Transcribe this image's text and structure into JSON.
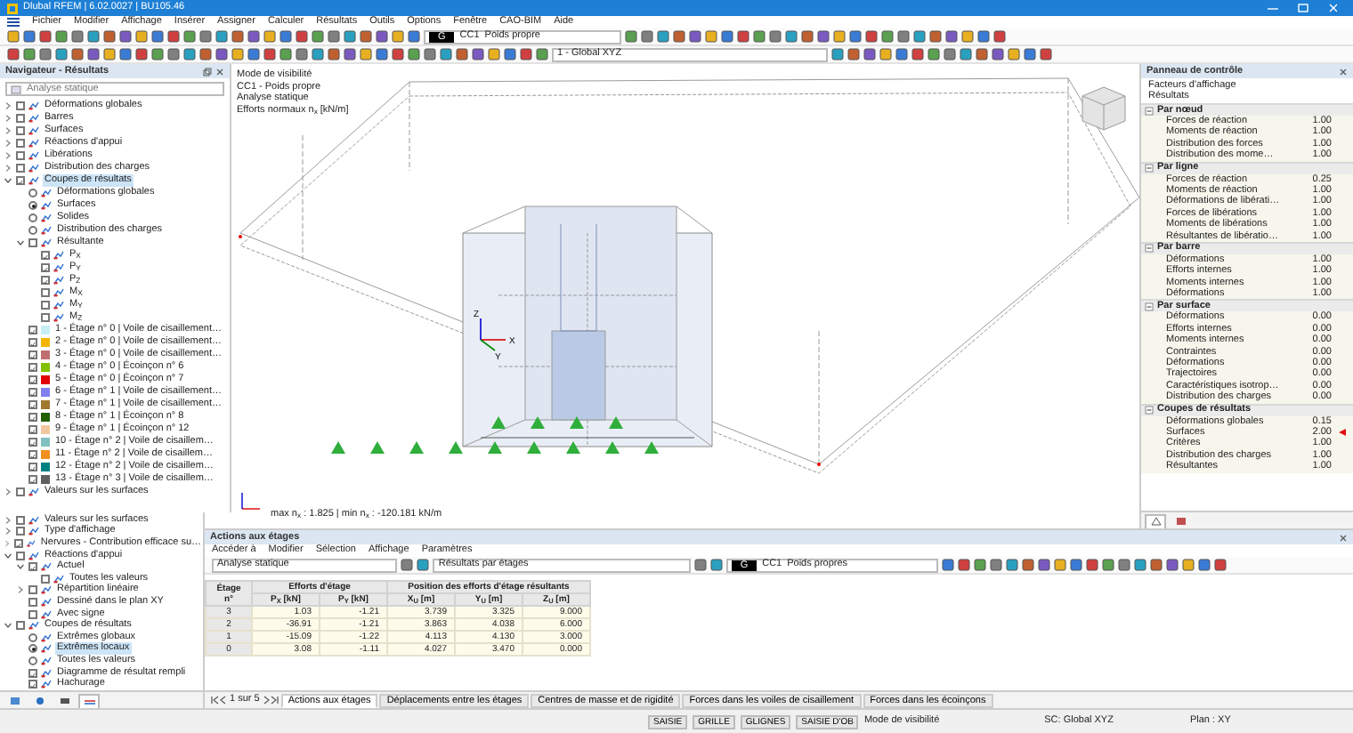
{
  "window": {
    "title": "Dlubal RFEM | 6.02.0027 | BU105.46"
  },
  "menu": [
    "Fichier",
    "Modifier",
    "Affichage",
    "Insérer",
    "Assigner",
    "Calculer",
    "Résultats",
    "Outils",
    "Options",
    "Fenêtre",
    "CAO-BIM",
    "Aide"
  ],
  "toolbar": {
    "case_badge": "G",
    "case": "CC1",
    "case_name": "Poids propre",
    "coordinate_system": "1 - Global XYZ"
  },
  "navigator": {
    "title": "Navigateur - Résultats",
    "analysis": "Analyse statique",
    "tree": [
      {
        "label": "Déformations globales",
        "kind": "checkbox",
        "checked": false,
        "expanded": false,
        "selected": false
      },
      {
        "label": "Barres",
        "kind": "checkbox",
        "checked": false,
        "expanded": false,
        "selected": false
      },
      {
        "label": "Surfaces",
        "kind": "checkbox",
        "checked": false,
        "expanded": false,
        "selected": false
      },
      {
        "label": "Réactions d'appui",
        "kind": "checkbox",
        "checked": false,
        "expanded": false,
        "selected": false
      },
      {
        "label": "Libérations",
        "kind": "checkbox",
        "checked": false,
        "expanded": false,
        "selected": false
      },
      {
        "label": "Distribution des charges",
        "kind": "checkbox",
        "checked": false,
        "expanded": false,
        "selected": false
      },
      {
        "label": "Coupes de résultats",
        "kind": "checkbox",
        "checked": true,
        "expanded": true,
        "selected": true,
        "children": [
          {
            "label": "Déformations globales",
            "kind": "radio",
            "checked": false,
            "selected": false
          },
          {
            "label": "Surfaces",
            "kind": "radio",
            "checked": true,
            "selected": false
          },
          {
            "label": "Solides",
            "kind": "radio",
            "checked": false,
            "selected": false
          },
          {
            "label": "Distribution des charges",
            "kind": "radio",
            "checked": false,
            "selected": false
          },
          {
            "label": "Résultante",
            "kind": "checkbox",
            "checked": false,
            "expanded": true,
            "selected": false,
            "children": [
              {
                "label": "P$_{X}$",
                "kind": "checkbox",
                "checked": true,
                "selected": false
              },
              {
                "label": "P$_{Y}$",
                "kind": "checkbox",
                "checked": true,
                "selected": false
              },
              {
                "label": "P$_{Z}$",
                "kind": "checkbox",
                "checked": true,
                "selected": false
              },
              {
                "label": "M$_{X}$",
                "kind": "checkbox",
                "checked": false,
                "selected": false
              },
              {
                "label": "M$_{Y}$",
                "kind": "checkbox",
                "checked": false,
                "selected": false
              },
              {
                "label": "M$_{Z}$",
                "kind": "checkbox",
                "checked": false,
                "selected": false
              }
            ]
          },
          {
            "label": "1 - Étage n° 0 | Voile de cisaillement…",
            "kind": "checkbox",
            "checked": true,
            "selected": false,
            "color": "#c8eef6"
          },
          {
            "label": "2 - Étage n° 0 | Voile de cisaillement…",
            "kind": "checkbox",
            "checked": true,
            "selected": false,
            "color": "#f2b600"
          },
          {
            "label": "3 - Étage n° 0 | Voile de cisaillement…",
            "kind": "checkbox",
            "checked": true,
            "selected": false,
            "color": "#c07070"
          },
          {
            "label": "4 - Étage n° 0 | Écoinçon n° 6",
            "kind": "checkbox",
            "checked": true,
            "selected": false,
            "color": "#80c000"
          },
          {
            "label": "5 - Étage n° 0 | Écoinçon n° 7",
            "kind": "checkbox",
            "checked": true,
            "selected": false,
            "color": "#e00000"
          },
          {
            "label": "6 - Étage n° 1 | Voile de cisaillement…",
            "kind": "checkbox",
            "checked": true,
            "selected": false,
            "color": "#8080f0"
          },
          {
            "label": "7 - Étage n° 1 | Voile de cisaillement…",
            "kind": "checkbox",
            "checked": true,
            "selected": false,
            "color": "#a07830"
          },
          {
            "label": "8 - Étage n° 1 | Écoinçon n° 8",
            "kind": "checkbox",
            "checked": true,
            "selected": false,
            "color": "#206000"
          },
          {
            "label": "9 - Étage n° 1 | Écoinçon n° 12",
            "kind": "checkbox",
            "checked": true,
            "selected": false,
            "color": "#f0c8a0"
          },
          {
            "label": "10 - Étage n° 2 | Voile de cisaillem…",
            "kind": "checkbox",
            "checked": true,
            "selected": false,
            "color": "#80c0c0"
          },
          {
            "label": "11 - Étage n° 2 | Voile de cisaillem…",
            "kind": "checkbox",
            "checked": true,
            "selected": false,
            "color": "#f09020"
          },
          {
            "label": "12 - Étage n° 2 | Voile de cisaillem…",
            "kind": "checkbox",
            "checked": true,
            "selected": false,
            "color": "#008080"
          },
          {
            "label": "13 - Étage n° 3 | Voile de cisaillem…",
            "kind": "checkbox",
            "checked": true,
            "selected": false,
            "color": "#606060"
          }
        ]
      },
      {
        "label": "Valeurs sur les surfaces",
        "kind": "checkbox",
        "checked": false,
        "expanded": false,
        "selected": false
      }
    ],
    "tree2": [
      {
        "label": "Valeurs sur les surfaces",
        "kind": "checkbox",
        "checked": false,
        "expanded": false,
        "selected": false
      },
      {
        "label": "Type d'affichage",
        "kind": "checkbox",
        "checked": false,
        "expanded": false,
        "selected": false
      },
      {
        "label": "Nervures - Contribution efficace su…",
        "kind": "checkbox",
        "checked": true,
        "expanded": false,
        "selected": false
      },
      {
        "label": "Réactions d'appui",
        "kind": "checkbox",
        "checked": false,
        "expanded": true,
        "selected": false,
        "children": [
          {
            "label": "Actuel",
            "kind": "checkbox",
            "checked": true,
            "expanded": true,
            "selected": false,
            "children": [
              {
                "label": "Toutes les valeurs",
                "kind": "checkbox",
                "checked": false,
                "selected": false
              }
            ]
          },
          {
            "label": "Répartition linéaire",
            "kind": "checkbox",
            "checked": false,
            "expanded": false,
            "selected": false
          },
          {
            "label": "Dessiné dans le plan XY",
            "kind": "checkbox",
            "checked": false,
            "selected": false
          },
          {
            "label": "Avec signe",
            "kind": "checkbox",
            "checked": false,
            "selected": false
          }
        ]
      },
      {
        "label": "Coupes de résultats",
        "kind": "checkbox",
        "checked": false,
        "expanded": true,
        "selected": false,
        "children": [
          {
            "label": "Extrêmes globaux",
            "kind": "radio",
            "checked": false,
            "selected": false
          },
          {
            "label": "Extrêmes locaux",
            "kind": "radio",
            "checked": true,
            "selected": true
          },
          {
            "label": "Toutes les valeurs",
            "kind": "radio",
            "checked": false,
            "selected": false
          },
          {
            "label": "Diagramme de résultat rempli",
            "kind": "checkbox",
            "checked": true,
            "selected": false
          },
          {
            "label": "Hachurage",
            "kind": "checkbox",
            "checked": true,
            "selected": false
          }
        ]
      }
    ],
    "bottom_tabs": [
      {
        "selected": false
      },
      {
        "selected": false
      },
      {
        "selected": false
      },
      {
        "selected": true
      }
    ]
  },
  "view": {
    "info": [
      "Mode de visibilité",
      "CC1 - Poids propre",
      "Analyse statique",
      "Efforts normaux n$_{x}$ [kN/m]"
    ],
    "summary": "max n$_{x}$ : 1.825 | min n$_{x}$ : -120.181 kN/m",
    "axes": [
      "X",
      "Y",
      "Z"
    ]
  },
  "control_panel": {
    "title": "Panneau de contrôle",
    "subtitle": "Facteurs d'affichage",
    "section": "Résultats",
    "groups": [
      {
        "title": "Par nœud",
        "expanded": true,
        "rows": [
          {
            "label": "Forces de réaction",
            "value": "1.00",
            "marked": false
          },
          {
            "label": "Moments de réaction",
            "value": "1.00",
            "marked": false
          },
          {
            "label": "Distribution des forces",
            "value": "1.00",
            "marked": false
          },
          {
            "label": "Distribution des mome…",
            "value": "1.00",
            "marked": false
          }
        ]
      },
      {
        "title": "Par ligne",
        "expanded": true,
        "rows": [
          {
            "label": "Forces de réaction",
            "value": "0.25",
            "marked": false
          },
          {
            "label": "Moments de réaction",
            "value": "1.00",
            "marked": false
          },
          {
            "label": "Déformations de libérati…",
            "value": "1.00",
            "marked": false
          },
          {
            "label": "Forces de libérations",
            "value": "1.00",
            "marked": false
          },
          {
            "label": "Moments de libérations",
            "value": "1.00",
            "marked": false
          },
          {
            "label": "Résultantes de libératio…",
            "value": "1.00",
            "marked": false
          }
        ]
      },
      {
        "title": "Par barre",
        "expanded": true,
        "rows": [
          {
            "label": "Déformations",
            "value": "1.00",
            "marked": false
          },
          {
            "label": "Efforts internes",
            "value": "1.00",
            "marked": false
          },
          {
            "label": "Moments internes",
            "value": "1.00",
            "marked": false
          },
          {
            "label": "Déformations",
            "value": "1.00",
            "marked": false
          }
        ]
      },
      {
        "title": "Par surface",
        "expanded": true,
        "rows": [
          {
            "label": "Déformations",
            "value": "0.00",
            "marked": false
          },
          {
            "label": "Efforts internes",
            "value": "0.00",
            "marked": false
          },
          {
            "label": "Moments internes",
            "value": "0.00",
            "marked": false
          },
          {
            "label": "Contraintes",
            "value": "0.00",
            "marked": false
          },
          {
            "label": "Déformations",
            "value": "0.00",
            "marked": false
          },
          {
            "label": "Trajectoires",
            "value": "0.00",
            "marked": false
          },
          {
            "label": "Caractéristiques isotrop…",
            "value": "0.00",
            "marked": false
          },
          {
            "label": "Distribution des charges",
            "value": "0.00",
            "marked": false
          }
        ]
      },
      {
        "title": "Coupes de résultats",
        "expanded": true,
        "rows": [
          {
            "label": "Déformations globales",
            "value": "0.15",
            "marked": false
          },
          {
            "label": "Surfaces",
            "value": "2.00",
            "marked": true
          },
          {
            "label": "Critères",
            "value": "1.00",
            "marked": false
          },
          {
            "label": "Distribution des charges",
            "value": "1.00",
            "marked": false
          },
          {
            "label": "Résultantes",
            "value": "1.00",
            "marked": false
          }
        ]
      }
    ]
  },
  "table_panel": {
    "title": "Actions aux étages",
    "menu": [
      "Accéder à",
      "Modifier",
      "Sélection",
      "Affichage",
      "Paramètres"
    ],
    "analysis": "Analyse statique",
    "results": "Résultats par étages",
    "case_badge": "G",
    "case": "CC1",
    "case_name": "Poids propres",
    "first_column": "Étage n°",
    "column_groups": [
      {
        "label": "Efforts d'étage",
        "columns": [
          "P$_{X}$ [kN]",
          "P$_{Y}$ [kN]"
        ]
      },
      {
        "label": "Position des efforts d'étage résultants",
        "columns": [
          "X$_{U}$ [m]",
          "Y$_{U}$ [m]",
          "Z$_{U}$ [m]"
        ]
      }
    ],
    "rows": [
      {
        "storey": "3",
        "cells": [
          "1.03",
          "-1.21",
          "3.739",
          "3.325",
          "9.000"
        ]
      },
      {
        "storey": "2",
        "cells": [
          "-36.91",
          "-1.21",
          "3.863",
          "4.038",
          "6.000"
        ]
      },
      {
        "storey": "1",
        "cells": [
          "-15.09",
          "-1.22",
          "4.113",
          "4.130",
          "3.000"
        ]
      },
      {
        "storey": "0",
        "cells": [
          "3.08",
          "-1.11",
          "4.027",
          "3.470",
          "0.000"
        ]
      }
    ],
    "pager": "1 sur 5",
    "tabs": [
      {
        "label": "Actions aux étages",
        "selected": true
      },
      {
        "label": "Déplacements entre les étages",
        "selected": false
      },
      {
        "label": "Centres de masse et de rigidité",
        "selected": false
      },
      {
        "label": "Forces dans les voiles de cisaillement",
        "selected": false
      },
      {
        "label": "Forces dans les écoinçons",
        "selected": false
      }
    ]
  },
  "status_bar": {
    "toggles": [
      "SAISIE",
      "GRILLE",
      "GLIGNES",
      "SAISIE D'OB"
    ],
    "mode": "Mode de visibilité",
    "coordinate_system": "SC: Global XYZ",
    "plane": "Plan : XY"
  }
}
